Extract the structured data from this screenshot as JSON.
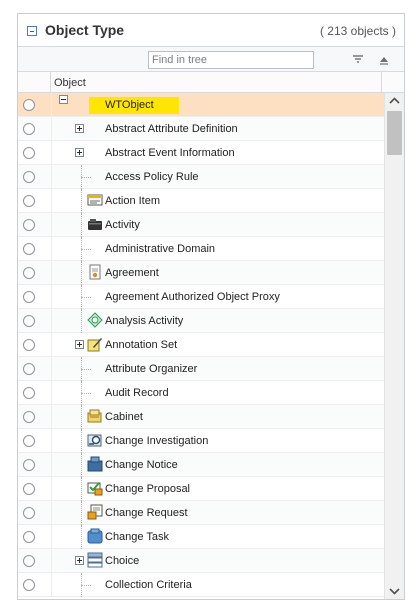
{
  "panel": {
    "title": "Object Type",
    "count": "( 213 objects )",
    "search": {
      "placeholder": "Find in tree",
      "value": ""
    },
    "column_header": "Object"
  },
  "tree": {
    "root": {
      "label": "WTObject",
      "selected": true
    },
    "items": [
      {
        "label": "Abstract Attribute Definition",
        "expander": "plus",
        "icon": ""
      },
      {
        "label": "Abstract Event Information",
        "expander": "plus",
        "icon": ""
      },
      {
        "label": "Access Policy Rule",
        "expander": "",
        "icon": ""
      },
      {
        "label": "Action Item",
        "expander": "",
        "icon": "action-item-icon"
      },
      {
        "label": "Activity",
        "expander": "",
        "icon": "activity-icon"
      },
      {
        "label": "Administrative Domain",
        "expander": "",
        "icon": ""
      },
      {
        "label": "Agreement",
        "expander": "",
        "icon": "agreement-icon"
      },
      {
        "label": "Agreement Authorized Object Proxy",
        "expander": "",
        "icon": ""
      },
      {
        "label": "Analysis Activity",
        "expander": "",
        "icon": "analysis-activity-icon"
      },
      {
        "label": "Annotation Set",
        "expander": "plus",
        "icon": "annotation-set-icon"
      },
      {
        "label": "Attribute Organizer",
        "expander": "",
        "icon": ""
      },
      {
        "label": "Audit Record",
        "expander": "",
        "icon": ""
      },
      {
        "label": "Cabinet",
        "expander": "",
        "icon": "cabinet-icon"
      },
      {
        "label": "Change Investigation",
        "expander": "",
        "icon": "change-investigation-icon"
      },
      {
        "label": "Change Notice",
        "expander": "",
        "icon": "change-notice-icon"
      },
      {
        "label": "Change Proposal",
        "expander": "",
        "icon": "change-proposal-icon"
      },
      {
        "label": "Change Request",
        "expander": "",
        "icon": "change-request-icon"
      },
      {
        "label": "Change Task",
        "expander": "",
        "icon": "change-task-icon"
      },
      {
        "label": "Choice",
        "expander": "plus",
        "icon": "choice-icon"
      },
      {
        "label": "Collection Criteria",
        "expander": "",
        "icon": ""
      }
    ]
  },
  "colors": {
    "selected_row": "#fde0c1",
    "highlight": "#ffe600",
    "border": "#c9ced4",
    "accent": "#2d5f9a"
  }
}
